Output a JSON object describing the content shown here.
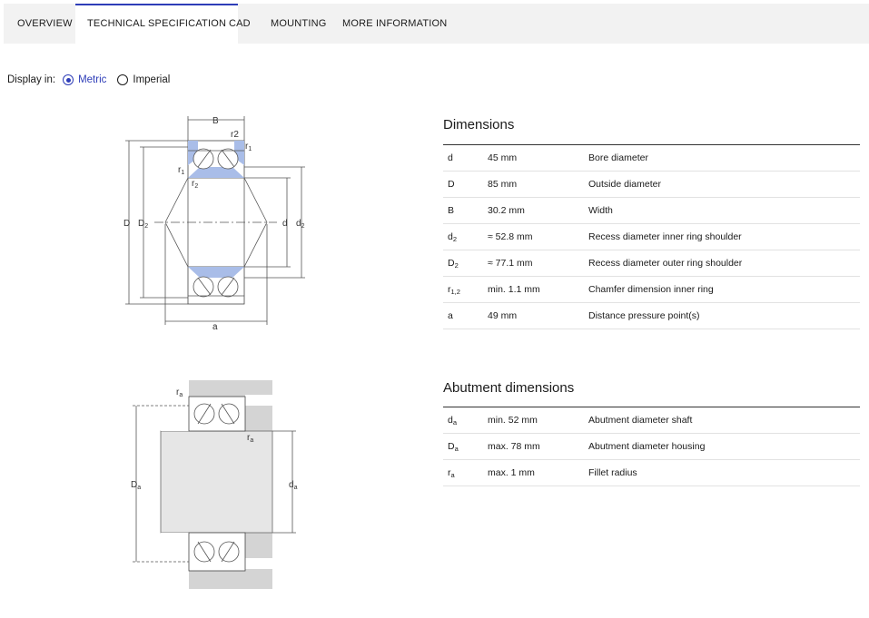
{
  "tabs": [
    {
      "label": "OVERVIEW",
      "active": false
    },
    {
      "label": "TECHNICAL SPECIFICATION",
      "active": true
    },
    {
      "label": "CAD",
      "active": false
    },
    {
      "label": "MOUNTING",
      "active": false
    },
    {
      "label": "MORE INFORMATION",
      "active": false
    }
  ],
  "display": {
    "prefix": "Display in:",
    "options": [
      "Metric",
      "Imperial"
    ],
    "selected": "Metric"
  },
  "colors": {
    "accent": "#2e3db8",
    "seal_blue": "#a9bde8",
    "housing_gray": "#d4d4d4"
  },
  "drawing_labels": {
    "main": {
      "B": "B",
      "r2_top": "r2",
      "r1_top": "r",
      "r1_top_sub": "1",
      "r1_left": "r",
      "r1_left_sub": "1",
      "r2_left": "r",
      "r2_left_sub": "2",
      "D": "D",
      "D2": "D",
      "D2_sub": "2",
      "d": "d",
      "d2": "d",
      "d2_sub": "2",
      "a": "a"
    },
    "abutment": {
      "ra_top": "r",
      "ra_top_sub": "a",
      "ra_mid": "r",
      "ra_mid_sub": "a",
      "Da": "D",
      "Da_sub": "a",
      "da": "d",
      "da_sub": "a"
    }
  },
  "dimensions": {
    "title": "Dimensions",
    "rows": [
      {
        "sym": "d",
        "sub": "",
        "value": "45 mm",
        "desc": "Bore diameter"
      },
      {
        "sym": "D",
        "sub": "",
        "value": "85 mm",
        "desc": "Outside diameter"
      },
      {
        "sym": "B",
        "sub": "",
        "value": "30.2 mm",
        "desc": "Width"
      },
      {
        "sym": "d",
        "sub": "2",
        "value": "≈ 52.8 mm",
        "desc": "Recess diameter inner ring shoulder"
      },
      {
        "sym": "D",
        "sub": "2",
        "value": "≈ 77.1 mm",
        "desc": "Recess diameter outer ring shoulder"
      },
      {
        "sym": "r",
        "sub": "1,2",
        "value": "min. 1.1 mm",
        "desc": "Chamfer dimension inner ring"
      },
      {
        "sym": "a",
        "sub": "",
        "value": "49 mm",
        "desc": "Distance pressure point(s)"
      }
    ]
  },
  "abutment": {
    "title": "Abutment dimensions",
    "rows": [
      {
        "sym": "d",
        "sub": "a",
        "value": "min. 52 mm",
        "desc": "Abutment diameter shaft"
      },
      {
        "sym": "D",
        "sub": "a",
        "value": "max. 78 mm",
        "desc": "Abutment diameter housing"
      },
      {
        "sym": "r",
        "sub": "a",
        "value": "max. 1 mm",
        "desc": "Fillet radius"
      }
    ]
  }
}
